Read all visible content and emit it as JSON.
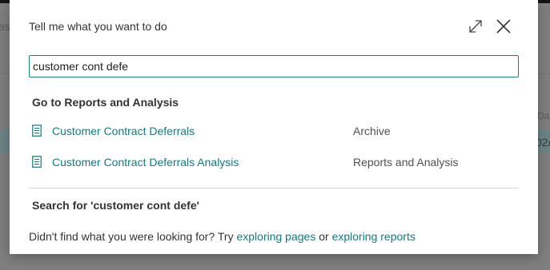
{
  "background": {
    "left_text": "as",
    "right_column_header": "Da",
    "right_column_value": "02/"
  },
  "dialog": {
    "title": "Tell me what you want to do",
    "expand_icon": "expand-icon",
    "close_icon": "close-icon",
    "search": {
      "value": "customer cont defe",
      "placeholder": ""
    },
    "section_heading": "Go to Reports and Analysis",
    "results": [
      {
        "name": "Customer Contract Deferrals",
        "category": "Archive",
        "icon": "report-document-icon"
      },
      {
        "name": "Customer Contract Deferrals Analysis",
        "category": "Reports and Analysis",
        "icon": "report-document-icon"
      }
    ],
    "search_for": "Search for 'customer cont defe'",
    "footer": {
      "prefix": "Didn't find what you were looking for? Try ",
      "link_pages": "exploring pages",
      "middle": " or ",
      "link_reports": "exploring reports"
    }
  },
  "colors": {
    "accent": "#137a80",
    "input_border": "#1a7f84",
    "overlay": "#7f7f7f"
  }
}
